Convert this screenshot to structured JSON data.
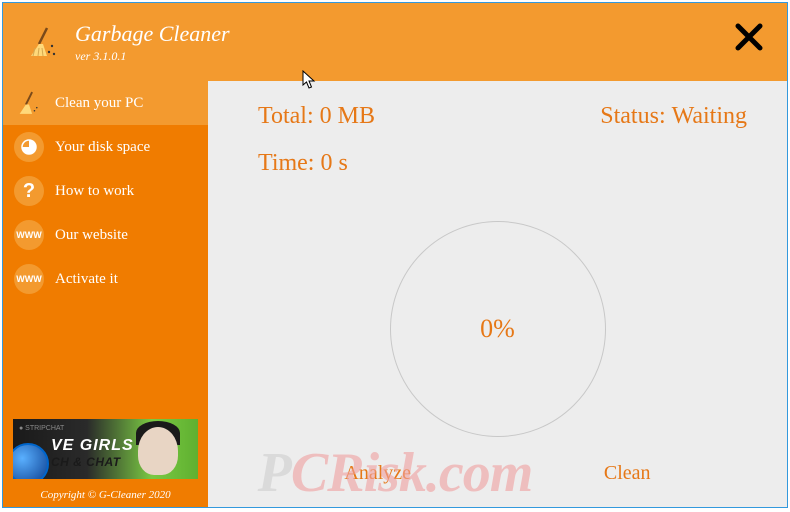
{
  "header": {
    "title": "Garbage Cleaner",
    "version": "ver 3.1.0.1"
  },
  "sidebar": {
    "items": [
      {
        "label": "Clean your PC",
        "icon": "broom"
      },
      {
        "label": "Your disk space",
        "icon": "disk"
      },
      {
        "label": "How to work",
        "icon": "question"
      },
      {
        "label": "Our website",
        "icon": "www"
      },
      {
        "label": "Activate it",
        "icon": "www"
      }
    ]
  },
  "ad": {
    "badge": "● STRIPCHAT",
    "line1": "VE GIRLS",
    "line2": "CH & CHAT"
  },
  "copyright": "Copyright © G-Cleaner 2020",
  "main": {
    "total_label": "Total:",
    "total_value": "0 MB",
    "status_label": "Status:",
    "status_value": "Waiting",
    "time_label": "Time:",
    "time_value": "0 s",
    "progress": "0%",
    "analyze_label": "Analyze",
    "clean_label": "Clean"
  },
  "watermark": {
    "grey": "P",
    "red": "CRisk.com"
  }
}
